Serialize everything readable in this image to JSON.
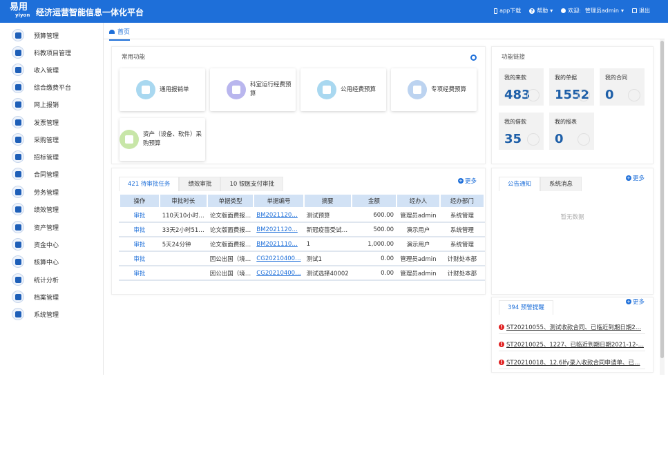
{
  "header": {
    "logo_cn": "易用",
    "logo_en": "yiyon",
    "title": "经济运营智能信息一体化平台",
    "app_download": "app下载",
    "help": "帮助",
    "welcome": "欢迎:",
    "user": "管理员admin",
    "logout": "退出"
  },
  "sidebar": {
    "items": [
      {
        "label": "预算管理",
        "icon": "money-bag-icon"
      },
      {
        "label": "科教项目管理",
        "icon": "layers-icon"
      },
      {
        "label": "收入管理",
        "icon": "download-icon"
      },
      {
        "label": "综合缴费平台",
        "icon": "user-pay-icon"
      },
      {
        "label": "网上报销",
        "icon": "book-icon"
      },
      {
        "label": "发票管理",
        "icon": "invoice-icon"
      },
      {
        "label": "采购管理",
        "icon": "cart-icon"
      },
      {
        "label": "招标管理",
        "icon": "target-icon"
      },
      {
        "label": "合同管理",
        "icon": "document-icon"
      },
      {
        "label": "劳务管理",
        "icon": "worker-icon"
      },
      {
        "label": "绩效管理",
        "icon": "medal-icon"
      },
      {
        "label": "资产管理",
        "icon": "home-icon"
      },
      {
        "label": "资金中心",
        "icon": "coin-icon"
      },
      {
        "label": "核算中心",
        "icon": "grid-icon"
      },
      {
        "label": "统计分析",
        "icon": "bar-chart-icon"
      },
      {
        "label": "档案管理",
        "icon": "archive-icon"
      },
      {
        "label": "系统管理",
        "icon": "gear-icon"
      }
    ]
  },
  "tabs": {
    "home": "首页"
  },
  "common": {
    "title": "常用功能",
    "items": [
      {
        "label": "通用报销单",
        "color": "#a9d8f0"
      },
      {
        "label": "科室运行经费预算",
        "color": "#b9b6ee"
      },
      {
        "label": "公用经费预算",
        "color": "#a9d8f0"
      },
      {
        "label": "专项经费预算",
        "color": "#bcd3f0"
      },
      {
        "label": "资产（设备、软件）采购预算",
        "color": "#c8e6a8"
      }
    ]
  },
  "links": {
    "title": "功能链接",
    "cards": [
      {
        "label": "我的来款",
        "value": "483"
      },
      {
        "label": "我的单据",
        "value": "1552"
      },
      {
        "label": "我的合同",
        "value": "0"
      },
      {
        "label": "我的借款",
        "value": "35"
      },
      {
        "label": "我的报表",
        "value": "0"
      }
    ]
  },
  "approval": {
    "tabs": [
      "421 待审批任务",
      "绩效审批",
      "10 银医支付审批"
    ],
    "more": "更多",
    "columns": [
      "操作",
      "审批时长",
      "单据类型",
      "单据编号",
      "摘要",
      "金额",
      "经办人",
      "经办部门"
    ],
    "rows": [
      [
        "审批",
        "110天10小时…",
        "论文版面费报…",
        "BM2021120…",
        "测试预算",
        "600.00",
        "管理员admin",
        "系统管理"
      ],
      [
        "审批",
        "33天2小时51…",
        "论文版面费报…",
        "BM2021120…",
        "新冠疫苗受试…",
        "500.00",
        "演示用户",
        "系统管理"
      ],
      [
        "审批",
        "5天24分钟",
        "论文版面费报…",
        "BM2021110…",
        "1",
        "1,000.00",
        "演示用户",
        "系统管理"
      ],
      [
        "审批",
        "",
        "因公出国（境…",
        "CG20210400…",
        "测试1",
        "0.00",
        "管理员admin",
        "计财处本部"
      ],
      [
        "审批",
        "",
        "因公出国（境…",
        "CG20210400…",
        "测试选择40002",
        "0.00",
        "管理员admin",
        "计财处本部"
      ]
    ]
  },
  "notice": {
    "tabs": [
      "公告通知",
      "系统消息"
    ],
    "more": "更多",
    "empty": "暂无数据"
  },
  "warning": {
    "tab": "394 预警提醒",
    "more": "更多",
    "items": [
      "ST20210055、测试收款合同、已临近到期日期2…",
      "ST20210025、1227、已临近到期日期2021-12-…",
      "ST20210018、12.6lfy录入收款合同申请单、已…"
    ]
  }
}
